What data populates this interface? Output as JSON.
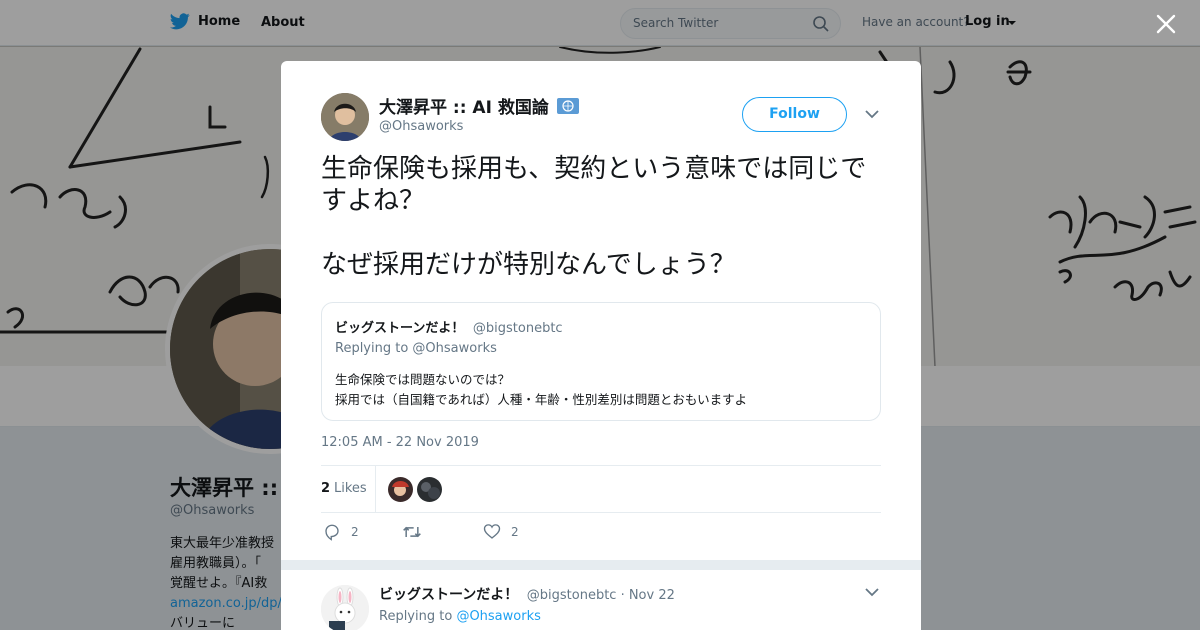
{
  "topbar": {
    "home_label": "Home",
    "about_label": "About",
    "search_placeholder": "Search Twitter",
    "account_prompt": "Have an account?",
    "login_label": "Log in"
  },
  "profile": {
    "name_truncated": "大澤昇平 ::",
    "handle": "@Ohsaworks",
    "bio_line1": "東大最年少准教授",
    "bio_line2": "雇用教職員）。「",
    "bio_line3": "覚醒せよ。『AI救",
    "bio_link": "amazon.co.jp/dp/4",
    "bio_line5": "バリューに"
  },
  "tweet": {
    "author_name": "大澤昇平 :: AI 救国論",
    "author_handle": "@Ohsaworks",
    "follow_label": "Follow",
    "text": "生命保険も採用も、契約という意味では同じですよね？\n\nなぜ採用だけが特別なんでしょう？",
    "timestamp": "12:05 AM - 22 Nov 2019",
    "likes_count": "2",
    "likes_label": "Likes",
    "reply_count": "2",
    "retweet_count": "",
    "like_count": "2"
  },
  "quoted": {
    "name": "ビッグストーンだよ！",
    "handle": "@bigstonebtc",
    "replying_to": "Replying to @Ohsaworks",
    "text": "生命保険では問題ないのでは？\n採用では（自国籍であれば）人種・年齢・性別差別は問題とおもいますよ"
  },
  "reply": {
    "name": "ビッグストーンだよ！",
    "meta": "@bigstonebtc · Nov 22",
    "replying_prefix": "Replying to",
    "replying_handle": "@Ohsaworks"
  },
  "colors": {
    "accent": "#1da1f2",
    "text": "#14171a",
    "muted": "#657786",
    "border": "#e6ecf0"
  },
  "icons": [
    "twitter-bird-icon",
    "search-icon",
    "close-icon",
    "verified-badge-icon",
    "chevron-down-icon",
    "reply-icon",
    "retweet-icon",
    "heart-icon"
  ]
}
